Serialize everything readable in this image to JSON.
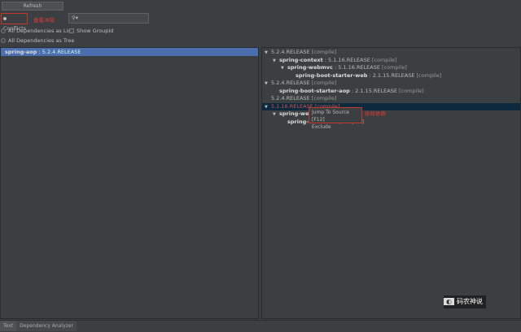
{
  "toolbar": {
    "refresh": "Refresh",
    "conflicts": "Conflicts",
    "conflicts_note": "查看冲突",
    "search_placeholder": "",
    "all_list": "All Dependencies as List",
    "show_groupid": "Show GroupId",
    "all_tree": "All Dependencies as Tree"
  },
  "left": {
    "items": [
      {
        "name": "spring-aop",
        "version": " : 5.2.4.RELEASE"
      }
    ]
  },
  "right": {
    "rows": [
      {
        "indent": 0,
        "arrow": true,
        "name": "",
        "version": "5.2.4.RELEASE",
        "scope": " [compile]"
      },
      {
        "indent": 1,
        "arrow": true,
        "name": "spring-context",
        "version": " : 5.1.16.RELEASE",
        "scope": " [compile]"
      },
      {
        "indent": 2,
        "arrow": true,
        "name": "spring-webmvc",
        "version": " : 5.1.16.RELEASE",
        "scope": " [compile]"
      },
      {
        "indent": 3,
        "arrow": false,
        "name": "spring-boot-starter-web",
        "version": " : 2.1.15.RELEASE",
        "scope": " [compile]"
      },
      {
        "indent": 0,
        "arrow": true,
        "name": "",
        "version": "5.2.4.RELEASE",
        "scope": " [compile]"
      },
      {
        "indent": 1,
        "arrow": false,
        "name": "spring-boot-starter-aop",
        "version": " : 2.1.15.RELEASE",
        "scope": " [compile]"
      },
      {
        "indent": 0,
        "arrow": false,
        "name": "",
        "version": "5.2.4.RELEASE",
        "scope": " [compile]"
      },
      {
        "indent": 0,
        "arrow": true,
        "name": "",
        "version": "5.1.16.RELEASE",
        "scope": " [compile]",
        "conflict": true
      },
      {
        "indent": 1,
        "arrow": true,
        "name": "spring-web",
        "version": "",
        "scope": ""
      },
      {
        "indent": 2,
        "arrow": false,
        "name": "spring-b",
        "version": "",
        "scope": "ASE [compile]"
      }
    ]
  },
  "context_menu": {
    "items": [
      "Jump To Source [F12]",
      "Exclude"
    ],
    "note": "排除依赖"
  },
  "bottom_tabs": [
    "Text",
    "Dependency Analyzer"
  ],
  "watermark": "码农神说"
}
